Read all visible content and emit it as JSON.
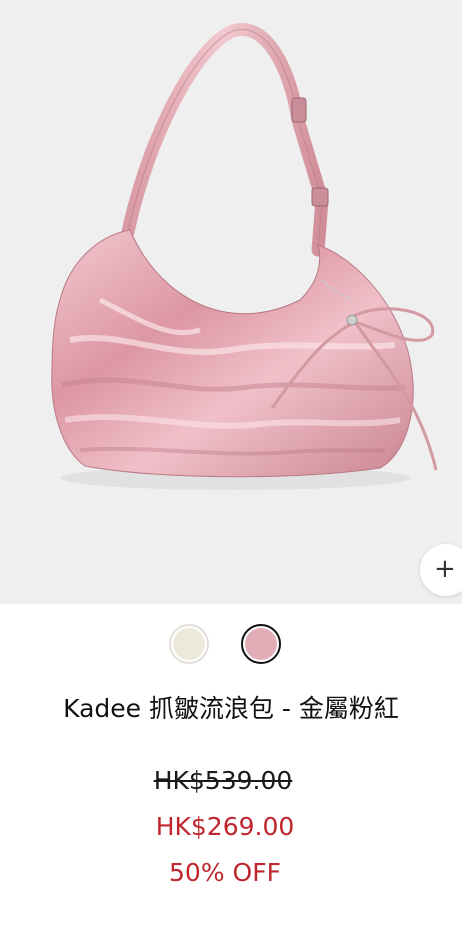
{
  "product": {
    "title": "Kadee 抓皺流浪包 - 金屬粉紅",
    "price_original": "HK$539.00",
    "price_sale": "HK$269.00",
    "discount": "50% OFF",
    "image_alt": "Pink metallic ruched hobo shoulder bag"
  },
  "actions": {
    "quick_add_icon": "plus-icon",
    "quick_add_symbol": "+"
  },
  "swatches": [
    {
      "name": "cream",
      "color": "#ede8dc",
      "selected": false
    },
    {
      "name": "metallic-pink",
      "color": "#e2adb6",
      "selected": true
    }
  ],
  "colors": {
    "image_background": "#efefef",
    "sale_red": "#c0262d",
    "text": "#111111"
  }
}
